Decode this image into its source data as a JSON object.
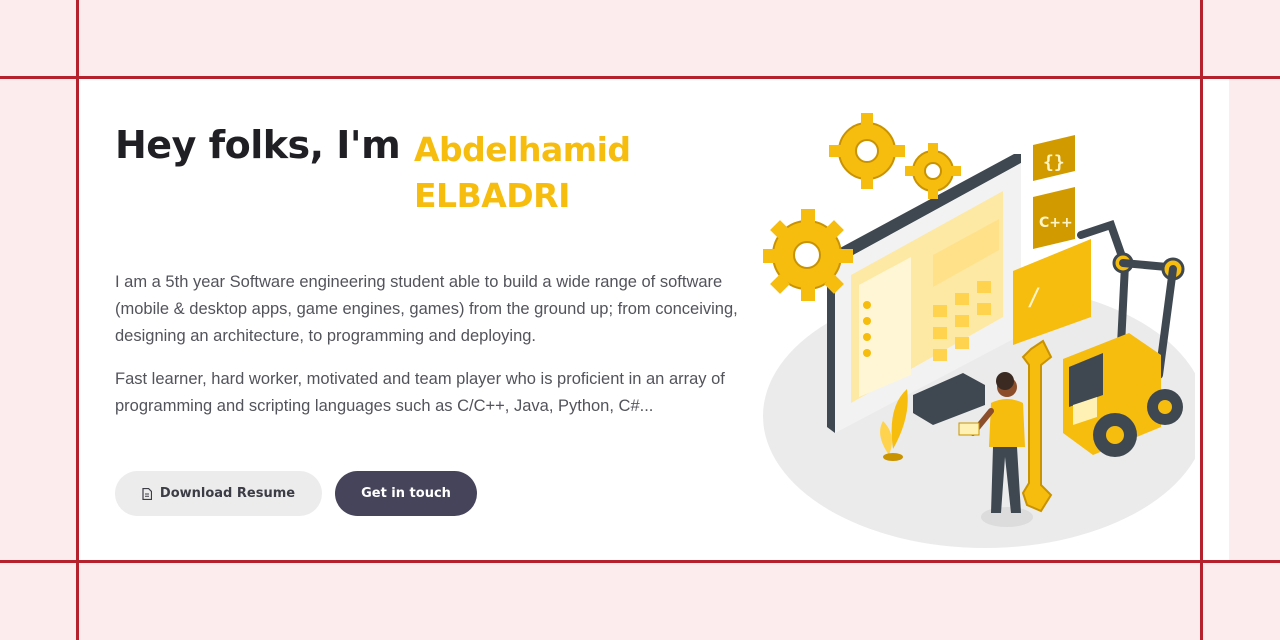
{
  "hero": {
    "greeting": "Hey folks, I'm",
    "name": "Abdelhamid ELBADRI",
    "paragraphs": [
      "I am a 5th year Software engineering student able to build a wide range of software (mobile & desktop apps, game engines, games) from the ground up; from conceiving, designing an architecture, to programming and deploying.",
      "Fast learner, hard worker, motivated and team player who is proficient in an array of programming and scripting languages such as C/C++, Java, Python, C#..."
    ],
    "buttons": {
      "resume_label": "Download Resume",
      "contact_label": "Get in touch"
    }
  },
  "illustration": {
    "code_labels": [
      "{}",
      "C++",
      "/"
    ],
    "icons": [
      "file-icon",
      "gear-icon",
      "monitor-icon",
      "robot-arm-icon",
      "wrench-icon",
      "person-icon"
    ]
  },
  "colors": {
    "accent": "#f6bc0e",
    "heading": "#1f1f24",
    "body_text": "#53535c",
    "frame_line": "#b5222e",
    "page_bg": "#fdecee",
    "button_dark": "#46445a",
    "button_light": "#ececec"
  }
}
